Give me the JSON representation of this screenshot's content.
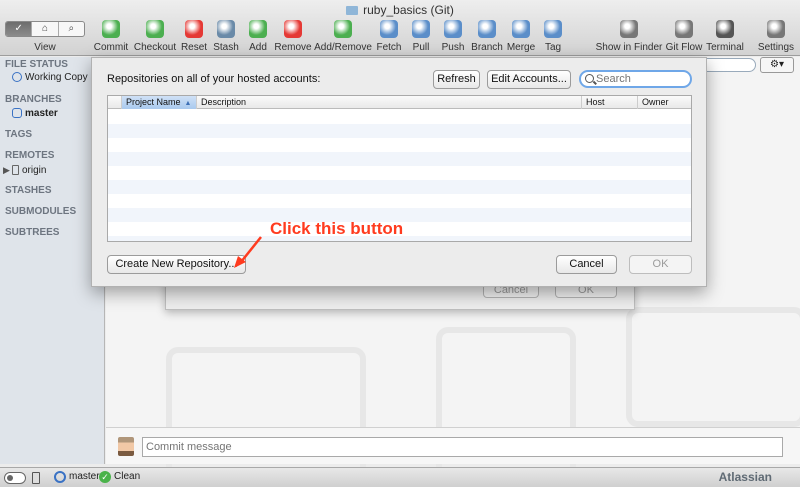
{
  "window": {
    "title": "ruby_basics (Git)"
  },
  "toolbar": {
    "view_label": "View",
    "view_segments": [
      "✓",
      "⌂",
      "⌕"
    ],
    "items": [
      {
        "label": "Commit",
        "icon": "commit-icon",
        "color": "#4caf50"
      },
      {
        "label": "Checkout",
        "icon": "checkout-icon",
        "color": "#4caf50"
      },
      {
        "label": "Reset",
        "icon": "reset-icon",
        "color": "#e53935"
      },
      {
        "label": "Stash",
        "icon": "stash-icon",
        "color": "#6a8aa8"
      },
      {
        "label": "Add",
        "icon": "add-icon",
        "color": "#4caf50"
      },
      {
        "label": "Remove",
        "icon": "remove-icon",
        "color": "#e53935"
      },
      {
        "label": "Add/Remove",
        "icon": "add-remove-icon",
        "color": "#4caf50"
      },
      {
        "label": "Fetch",
        "icon": "fetch-icon",
        "color": "#5b8ec9"
      },
      {
        "label": "Pull",
        "icon": "pull-icon",
        "color": "#5b8ec9"
      },
      {
        "label": "Push",
        "icon": "push-icon",
        "color": "#5b8ec9"
      },
      {
        "label": "Branch",
        "icon": "branch-icon",
        "color": "#5b8ec9"
      },
      {
        "label": "Merge",
        "icon": "merge-icon",
        "color": "#5b8ec9"
      },
      {
        "label": "Tag",
        "icon": "tag-icon",
        "color": "#5b8ec9"
      },
      {
        "label": "Show in Finder",
        "icon": "finder-icon",
        "color": "#777777"
      },
      {
        "label": "Git Flow",
        "icon": "git-flow-icon",
        "color": "#777777"
      },
      {
        "label": "Terminal",
        "icon": "terminal-icon",
        "color": "#555555"
      },
      {
        "label": "Settings",
        "icon": "settings-icon",
        "color": "#777777"
      }
    ]
  },
  "sidebar": {
    "file_status": "FILE STATUS",
    "working_copy": "Working Copy",
    "branches": "BRANCHES",
    "branch_master": "master",
    "tags": "TAGS",
    "remotes": "REMOTES",
    "remote_origin": "origin",
    "stashes": "STASHES",
    "submodules": "SUBMODULES",
    "subtrees": "SUBTREES"
  },
  "dialog": {
    "heading": "Repositories on all of your hosted accounts:",
    "refresh": "Refresh",
    "edit_accounts": "Edit Accounts...",
    "search_placeholder": "Search",
    "columns": {
      "project_name": "Project Name",
      "description": "Description",
      "host": "Host",
      "owner": "Owner"
    },
    "create_new": "Create New Repository...",
    "cancel": "Cancel",
    "ok": "OK"
  },
  "sheet_behind": {
    "cancel": "Cancel",
    "ok": "OK"
  },
  "annotation": {
    "text": "Click this button",
    "color": "#ff3b1f"
  },
  "commit": {
    "placeholder": "Commit message"
  },
  "statusbar": {
    "branch": "master",
    "state": "Clean",
    "brand": "Atlassian"
  }
}
